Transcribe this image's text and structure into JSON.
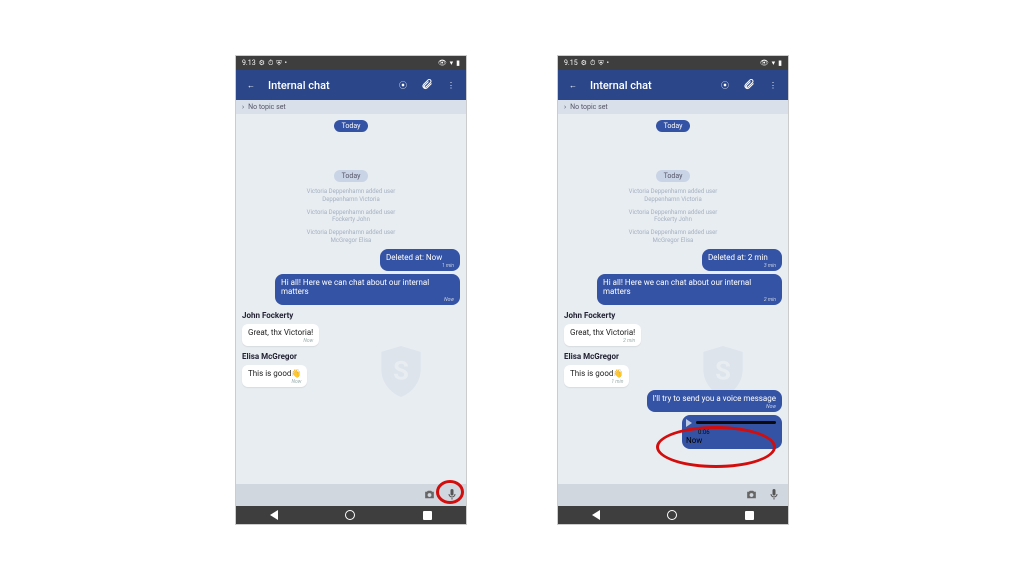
{
  "left": {
    "status_time": "9.13",
    "title": "Internal chat",
    "subbar": "No topic set",
    "daypill1": "Today",
    "daypill2": "Today",
    "syslogs": [
      "Victoria Deppenhamn added user\nDeppenhamn Victoria",
      "Victoria Deppenhamn added user\nFockerty John",
      "Victoria Deppenhamn added user\nMcGregor Elisa"
    ],
    "deleted_msg": "Deleted at: Now",
    "deleted_ts": "1 min",
    "welcome_msg": "Hi all! Here we can chat about our internal matters",
    "welcome_ts": "Now",
    "john_name": "John Fockerty",
    "john_msg": "Great, thx Victoria!",
    "john_ts": "Now",
    "elisa_name": "Elisa McGregor",
    "elisa_msg": "This is good👋",
    "elisa_ts": "Now"
  },
  "right": {
    "status_time": "9.15",
    "title": "Internal chat",
    "subbar": "No topic set",
    "daypill1": "Today",
    "daypill2": "Today",
    "syslogs": [
      "Victoria Deppenhamn added user\nDeppenhamn Victoria",
      "Victoria Deppenhamn added user\nFockerty John",
      "Victoria Deppenhamn added user\nMcGregor Elisa"
    ],
    "deleted_msg": "Deleted at: 2 min",
    "deleted_ts": "3 min",
    "welcome_msg": "Hi all! Here we can chat about our internal matters",
    "welcome_ts": "2 min",
    "john_name": "John Fockerty",
    "john_msg": "Great, thx Victoria!",
    "john_ts": "2 min",
    "elisa_name": "Elisa McGregor",
    "elisa_msg": "This is good👋",
    "elisa_ts": "1 min",
    "try_msg": "I'll try to send you a voice message",
    "try_ts": "Now",
    "voice_time": "0:06",
    "voice_ts": "Now"
  }
}
